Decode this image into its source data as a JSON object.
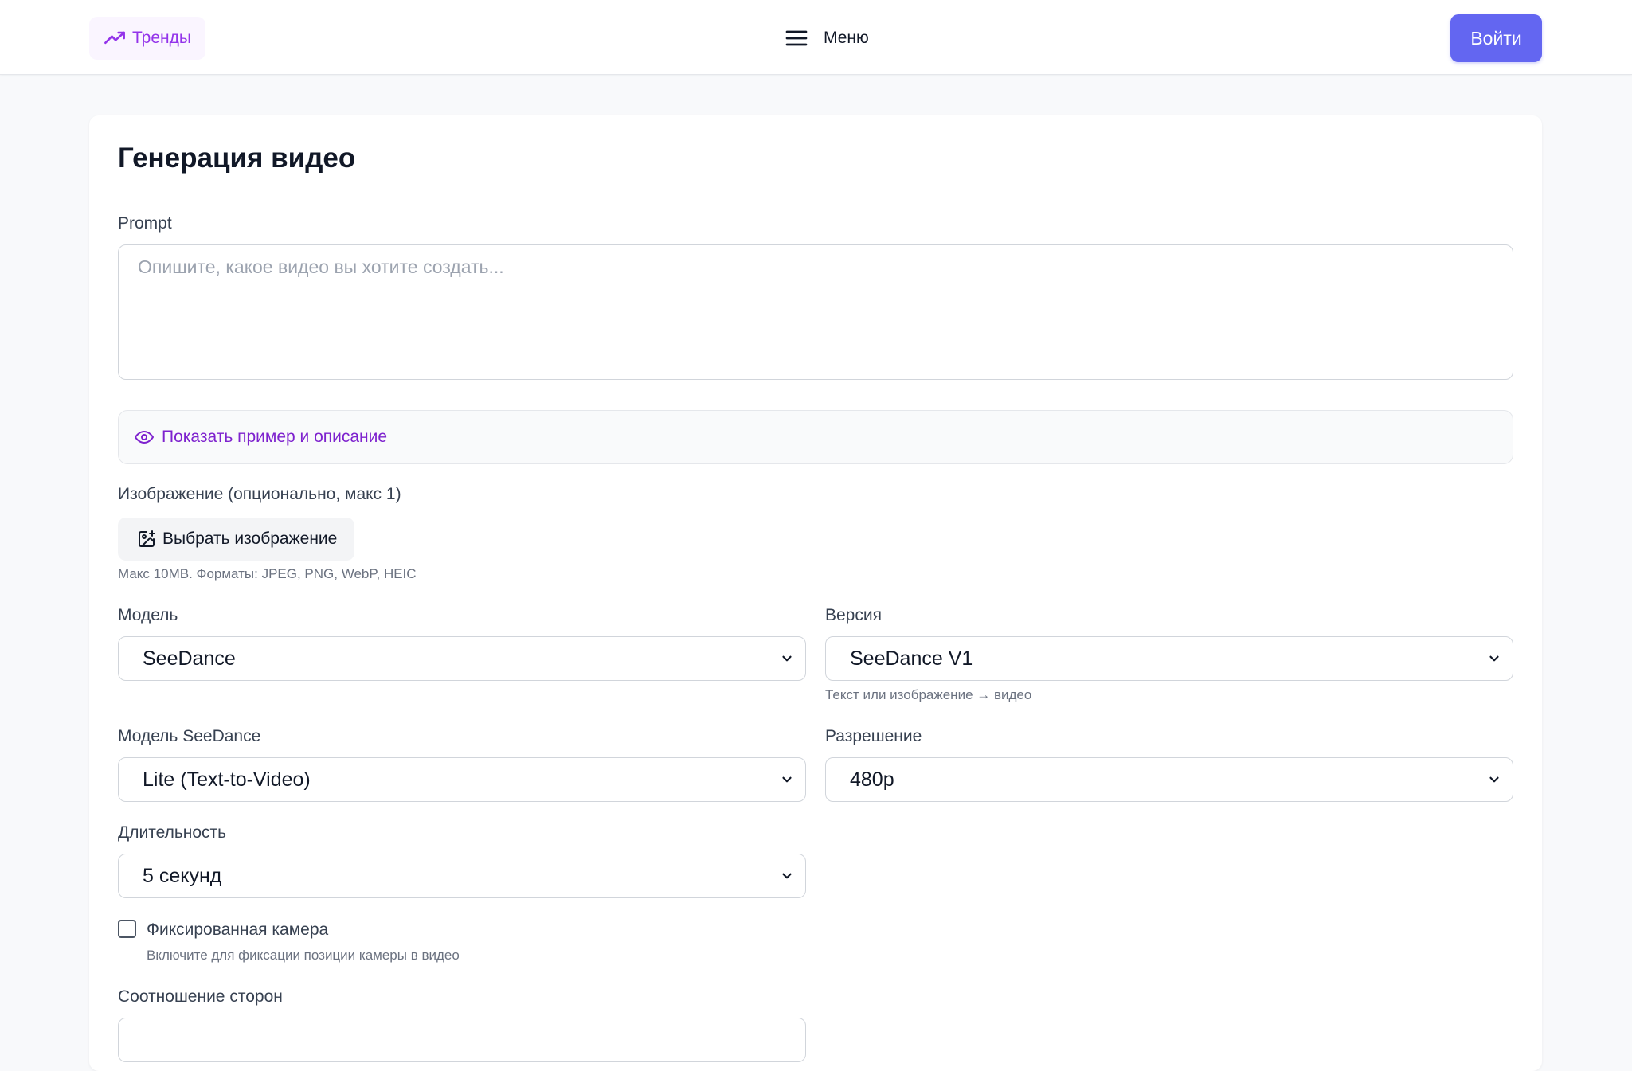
{
  "header": {
    "trends_label": "Тренды",
    "menu_label": "Меню",
    "login_label": "Войти"
  },
  "form": {
    "title": "Генерация видео",
    "prompt": {
      "label": "Prompt",
      "placeholder": "Опишите, какое видео вы хотите создать...",
      "value": ""
    },
    "example_toggle": "Показать пример и описание",
    "image": {
      "label": "Изображение (опционально, макс 1)",
      "button": "Выбрать изображение",
      "hint": "Макс 10MB. Форматы: JPEG, PNG, WebP, HEIC"
    },
    "model": {
      "label": "Модель",
      "value": "SeeDance"
    },
    "version": {
      "label": "Версия",
      "value": "SeeDance V1",
      "hint": "Текст или изображение → видео"
    },
    "seedance_model": {
      "label": "Модель SeeDance",
      "value": "Lite (Text-to-Video)"
    },
    "resolution": {
      "label": "Разрешение",
      "value": "480p"
    },
    "duration": {
      "label": "Длительность",
      "value": "5 секунд"
    },
    "fixed_camera": {
      "label": "Фиксированная камера",
      "hint": "Включите для фиксации позиции камеры в видео",
      "checked": false
    },
    "aspect_ratio": {
      "label": "Соотношение сторон"
    }
  },
  "colors": {
    "accent": "#6366f1",
    "purple_text": "#9333ea",
    "trends_bg": "#faf5ff"
  }
}
